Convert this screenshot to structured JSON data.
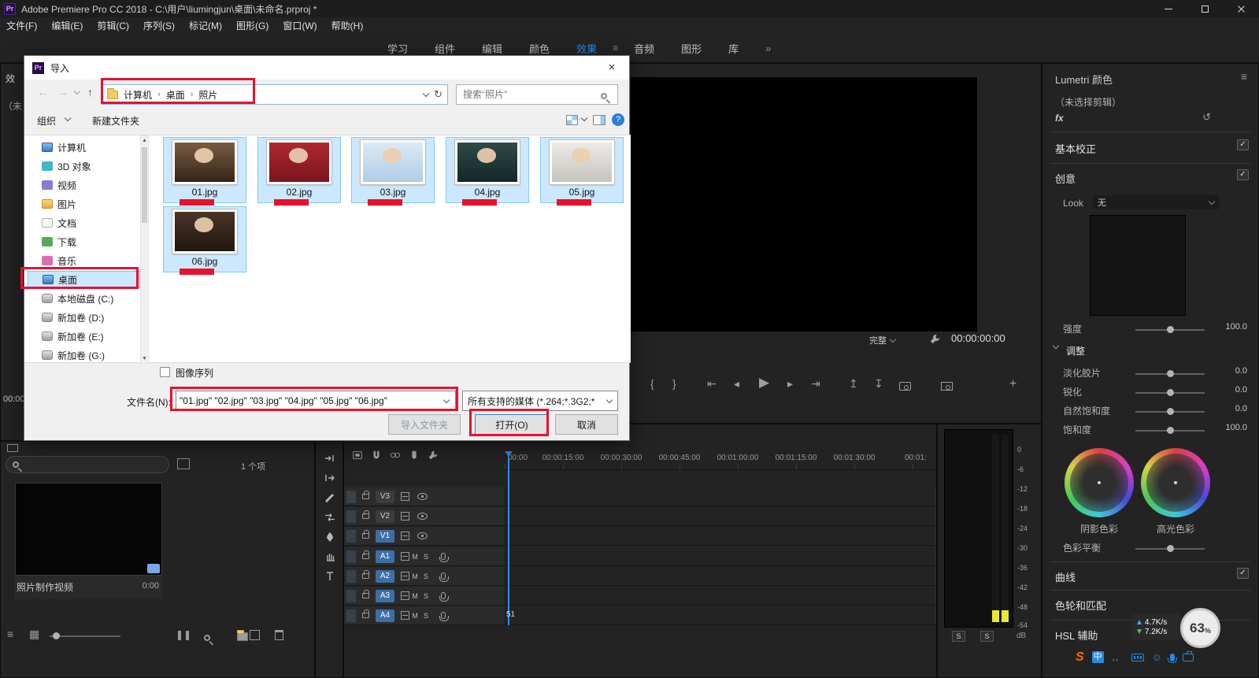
{
  "colors": {
    "accent_blue": "#2d8ceb",
    "annotation_red": "#e8112d",
    "selection_blue": "#cce8ff",
    "track_target_blue": "#3d6fa6"
  },
  "titlebar": {
    "logo": "Pr",
    "title": "Adobe Premiere Pro CC 2018 - C:\\用户\\liumingjun\\桌面\\未命名.prproj *"
  },
  "menubar": {
    "items": [
      "文件(F)",
      "编辑(E)",
      "剪辑(C)",
      "序列(S)",
      "标记(M)",
      "图形(G)",
      "窗口(W)",
      "帮助(H)"
    ]
  },
  "workspace": {
    "tabs": [
      "学习",
      "组件",
      "编辑",
      "颜色",
      "效果",
      "音频",
      "图形",
      "库"
    ],
    "overflow": "»"
  },
  "icons": {
    "check": "✓",
    "menu": "≡",
    "refresh": "↻",
    "reset": "↺",
    "back": "←",
    "forward": "→",
    "up": "↑",
    "help": "?",
    "mark_in": "{",
    "mark_out": "}",
    "go_in": "⇤",
    "step_back": "◂",
    "play": "▶",
    "step_fwd": "▸",
    "go_out": "⇥",
    "lift": "↥",
    "extract": "↧",
    "plus": "+",
    "up_tri": "▲",
    "down_tri": "▼",
    "smiley": "☺",
    "list": "≡",
    "grid": "▦"
  },
  "left_edge": {
    "effects_tab_fragment": "效",
    "no_clip_fragment": "（未",
    "timecode_fragment": "00:00"
  },
  "import_dialog": {
    "title": "导入",
    "logo": "Pr",
    "breadcrumb": [
      "计算机",
      "桌面",
      "照片"
    ],
    "breadcrumb_sep": "›",
    "search_placeholder": "搜索“照片”",
    "organize": "组织",
    "new_folder": "新建文件夹",
    "tree": [
      "计算机",
      "3D 对象",
      "视频",
      "图片",
      "文档",
      "下载",
      "音乐",
      "桌面",
      "本地磁盘 (C:)",
      "新加卷 (D:)",
      "新加卷 (E:)",
      "新加卷 (G:)"
    ],
    "files": [
      "01.jpg",
      "02.jpg",
      "03.jpg",
      "04.jpg",
      "05.jpg",
      "06.jpg"
    ],
    "image_sequence": "图像序列",
    "filename_label": "文件名(N):",
    "filename_value": "\"01.jpg\" \"02.jpg\" \"03.jpg\" \"04.jpg\" \"05.jpg\" \"06.jpg\"",
    "filter_value": "所有支持的媒体 (*.264;*.3G2;*",
    "import_folder_button": "导入文件夹",
    "open_button": "打开(O)",
    "cancel_button": "取消"
  },
  "program_monitor": {
    "fit": "完整",
    "timecode": "00:00:00:00"
  },
  "lumetri": {
    "title": "Lumetri 颜色",
    "no_clip": "（未选择剪辑）",
    "fx": "fx",
    "basic": "基本校正",
    "creative": "创意",
    "look_label": "Look",
    "look_value": "无",
    "intensity_label": "强度",
    "intensity_value": "100.0",
    "adjust": "调整",
    "sliders": [
      {
        "label": "淡化胶片",
        "value": "0.0"
      },
      {
        "label": "锐化",
        "value": "0.0"
      },
      {
        "label": "自然饱和度",
        "value": "0.0"
      },
      {
        "label": "饱和度",
        "value": "100.0"
      }
    ],
    "shadow_tint": "阴影色彩",
    "highlight_tint": "高光色彩",
    "tint_balance": "色彩平衡",
    "curves": "曲线",
    "wheels_match": "色轮和匹配",
    "hsl": "HSL 辅助"
  },
  "timeline": {
    "ruler": [
      "00:00",
      "00:00:15:00",
      "00:00:30:00",
      "00:00:45:00",
      "00:01:00:00",
      "00:01:15:00",
      "00:01:30:00",
      "00:01:"
    ],
    "video_tracks": [
      "V3",
      "V2",
      "V1"
    ],
    "audio_tracks": [
      "A1",
      "A2",
      "A3",
      "A4"
    ],
    "mute": "M",
    "solo": "S",
    "stray_label": "51"
  },
  "audio_meter": {
    "scale": [
      "0",
      "-6",
      "-12",
      "-18",
      "-24",
      "-30",
      "-36",
      "-42",
      "-48",
      "-54"
    ],
    "solo": "S",
    "db": "dB"
  },
  "project_panel": {
    "count": "1 个项",
    "item_name": "照片制作视频",
    "item_duration": "0:00"
  },
  "overlays": {
    "net_up": "4.7K/s",
    "net_down": "7.2K/s",
    "battery": "63",
    "percent": "%"
  },
  "ime": {
    "logo": "S",
    "mode": "中",
    "punct": "，。"
  }
}
